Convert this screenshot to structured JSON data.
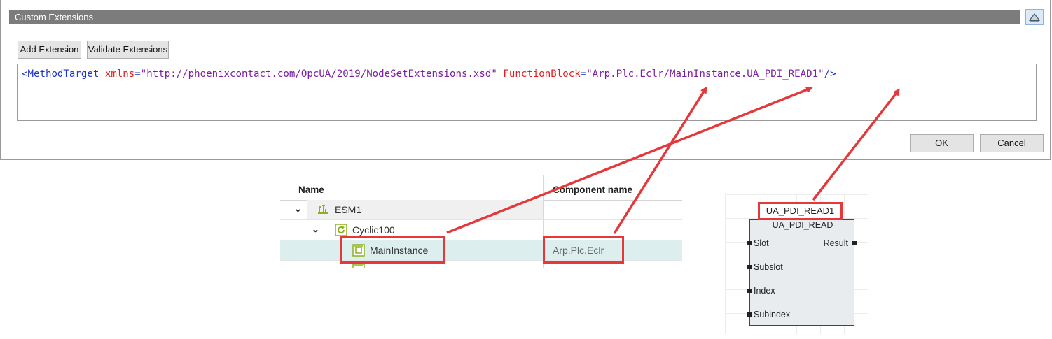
{
  "dialog": {
    "title": "Custom Extensions",
    "add_extension_label": "Add Extension",
    "validate_extensions_label": "Validate Extensions",
    "ok_label": "OK",
    "cancel_label": "Cancel",
    "collapse_icon": "collapse-up-icon",
    "xml": {
      "open": "<",
      "tag": "MethodTarget",
      "attr1_name": "xmlns",
      "attr1_value": "\"http://phoenixcontact.com/OpcUA/2019/NodeSetExtensions.xsd\"",
      "attr2_name": "FunctionBlock",
      "attr2_value": "\"Arp.Plc.Eclr/MainInstance.UA_PDI_READ1\"",
      "close": "/>",
      "eq": "="
    }
  },
  "tree": {
    "columns": {
      "name": "Name",
      "component": "Component name"
    },
    "rows": [
      {
        "label": "ESM1",
        "icon": "esm-icon",
        "component": ""
      },
      {
        "label": "Cyclic100",
        "icon": "cyclic-task-icon",
        "component": ""
      },
      {
        "label": "MainInstance",
        "icon": "program-instance-icon",
        "component": "Arp.Plc.Eclr"
      }
    ]
  },
  "function_block": {
    "instance_name": "UA_PDI_READ1",
    "type_name": "UA_PDI_READ",
    "inputs": [
      "Slot",
      "Subslot",
      "Index",
      "Subindex"
    ],
    "outputs": [
      "Result"
    ]
  },
  "colors": {
    "highlight": "#e5383b",
    "titlebar": "#7c7c7c",
    "selected_row": "#ddeeee",
    "xml_tag": "#1f35c7",
    "xml_attr": "#e01e1e",
    "xml_value": "#7b1fa2"
  }
}
